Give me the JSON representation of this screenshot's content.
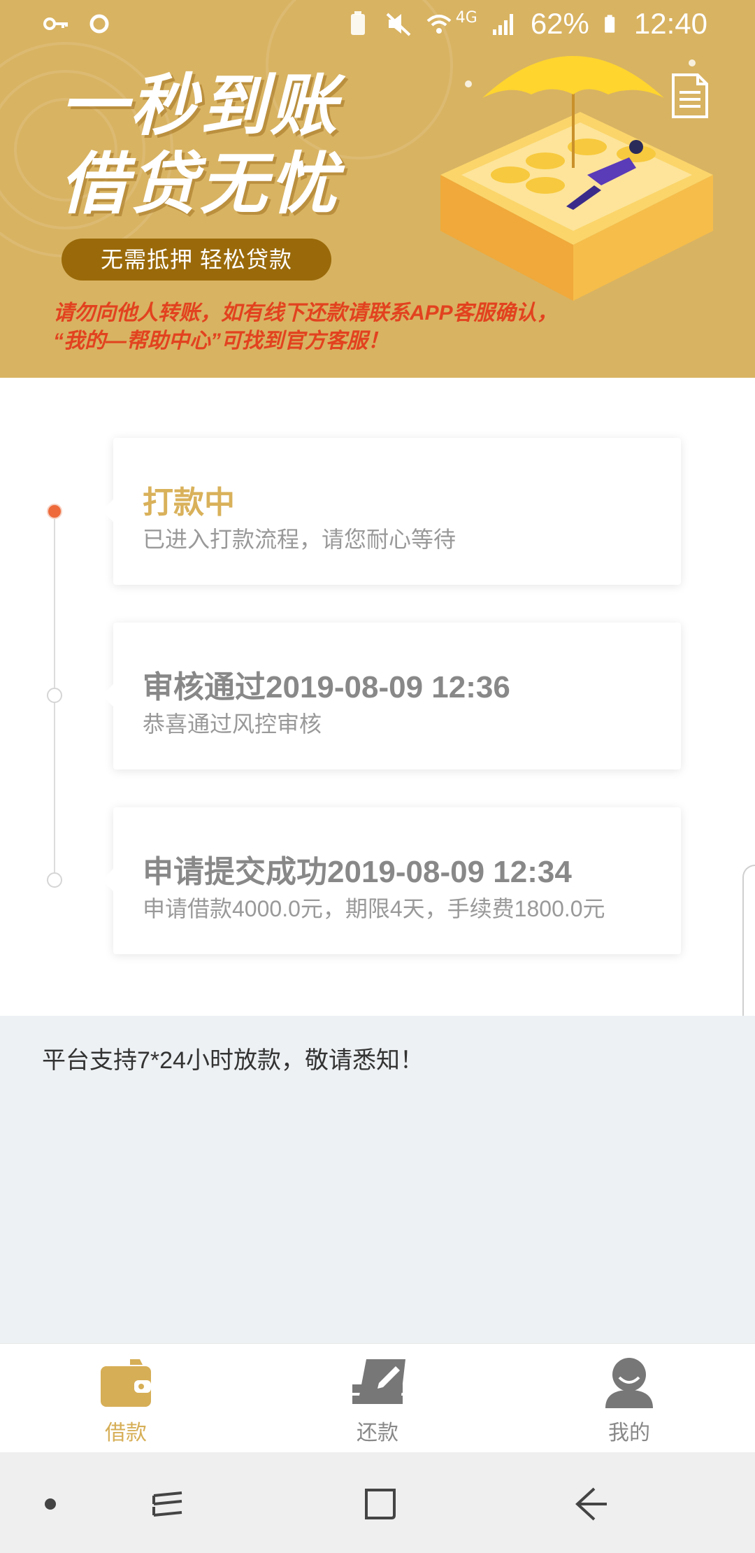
{
  "status_bar": {
    "battery_percent": "62%",
    "network": "4G",
    "time": "12:40"
  },
  "banner": {
    "headline_line1": "一秒到账",
    "headline_line2": "借贷无忧",
    "tagline": "无需抵押  轻松贷款",
    "warning_line1": "请勿向他人转账，如有线下还款请联系APP客服确认，",
    "warning_line2": "“我的—帮助中心”可找到官方客服！"
  },
  "timeline": [
    {
      "title": "打款中",
      "subtitle": "已进入打款流程，请您耐心等待",
      "active": true
    },
    {
      "title": "审核通过2019-08-09 12:36",
      "subtitle": "恭喜通过风控审核",
      "active": false
    },
    {
      "title": "申请提交成功2019-08-09 12:34",
      "subtitle": "申请借款4000.0元，期限4天，手续费1800.0元",
      "active": false
    }
  ],
  "notice": "平台支持7*24小时放款，敬请悉知！",
  "tabs": [
    {
      "label": "借款",
      "icon": "wallet-icon",
      "active": true
    },
    {
      "label": "还款",
      "icon": "repay-card-icon",
      "active": false
    },
    {
      "label": "我的",
      "icon": "user-profile-icon",
      "active": false
    }
  ],
  "colors": {
    "banner_bg": "#d8b362",
    "accent_gold": "#d9b15a",
    "active_dot": "#ee6a3b",
    "warning_red": "#e2421f",
    "notice_bg": "#eef1f4"
  }
}
